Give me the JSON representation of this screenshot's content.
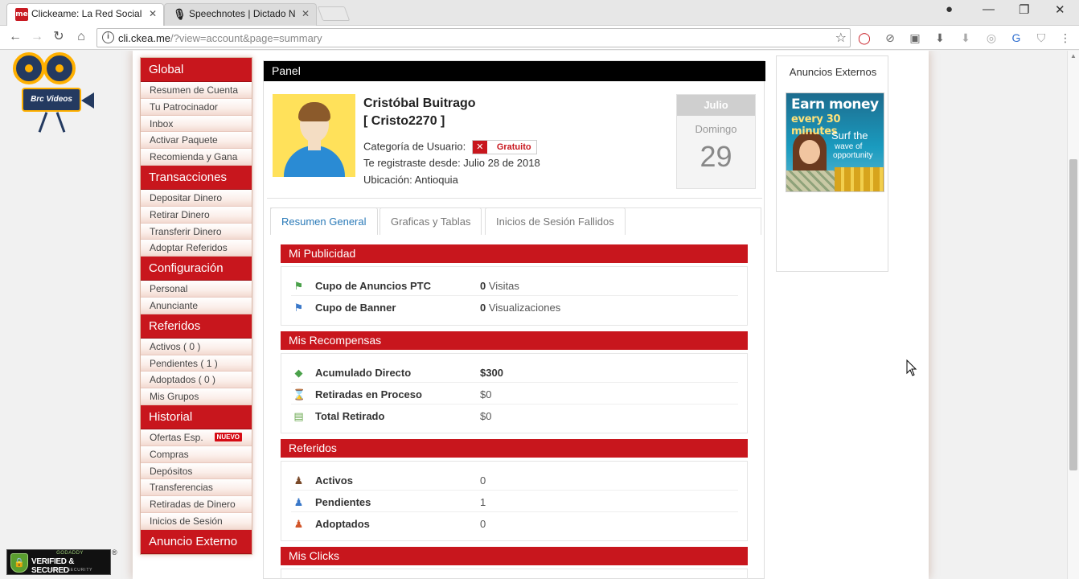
{
  "browser": {
    "tabs": [
      {
        "title": "Clickeame: La Red Social",
        "favicon": "me"
      },
      {
        "title": "Speechnotes | Dictado N",
        "favicon": "🎙"
      }
    ],
    "url_host": "cli.ckea.me",
    "url_path": "/?view=account&page=summary"
  },
  "logo": {
    "text": "Brc Videos"
  },
  "sidebar": {
    "sections": [
      {
        "title": "Global",
        "items": [
          "Resumen de Cuenta",
          "Tu Patrocinador",
          "Inbox",
          "Activar Paquete",
          "Recomienda y Gana"
        ]
      },
      {
        "title": "Transacciones",
        "items": [
          "Depositar Dinero",
          "Retirar Dinero",
          "Transferir Dinero",
          "Adoptar Referidos"
        ]
      },
      {
        "title": "Configuración",
        "items": [
          "Personal",
          "Anunciante"
        ]
      },
      {
        "title": "Referidos",
        "items": [
          "Activos ( 0 )",
          "Pendientes ( 1 )",
          "Adoptados ( 0 )",
          "Mis Grupos"
        ]
      },
      {
        "title": "Historial",
        "items": [
          "Ofertas Esp.",
          "Compras",
          "Depósitos",
          "Transferencias",
          "Retiradas de Dinero",
          "Inicios de Sesión"
        ]
      },
      {
        "title": "Anuncio Externo",
        "items": []
      }
    ],
    "new_badge": "NUEVO"
  },
  "panel": {
    "title": "Panel",
    "user": {
      "name": "Cristóbal Buitrago",
      "username": "[ Cristo2270 ]",
      "category_label": "Categoría de Usuario:",
      "category": "Gratuito",
      "registered": "Te registraste desde: Julio 28 de 2018",
      "location": "Ubicación: Antioquia"
    },
    "date": {
      "month": "Julio",
      "weekday": "Domingo",
      "day": "29"
    },
    "tabs": [
      "Resumen General",
      "Graficas y Tablas",
      "Inicios de Sesión Fallidos"
    ],
    "sections": {
      "publicidad": {
        "title": "Mi Publicidad",
        "rows": [
          {
            "label": "Cupo de Anuncios PTC",
            "num": "0",
            "unit": "Visitas"
          },
          {
            "label": "Cupo de Banner",
            "num": "0",
            "unit": "Visualizaciones"
          }
        ]
      },
      "recompensas": {
        "title": "Mis Recompensas",
        "rows": [
          {
            "label": "Acumulado Directo",
            "value": "$300"
          },
          {
            "label": "Retiradas en Proceso",
            "value": "$0"
          },
          {
            "label": "Total Retirado",
            "value": "$0"
          }
        ]
      },
      "referidos": {
        "title": "Referidos",
        "rows": [
          {
            "label": "Activos",
            "value": "0"
          },
          {
            "label": "Pendientes",
            "value": "1"
          },
          {
            "label": "Adoptados",
            "value": "0"
          }
        ]
      },
      "clicks": {
        "title": "Mis Clicks"
      }
    }
  },
  "ads": {
    "title": "Anuncios Externos",
    "banner": {
      "line1": "Earn money",
      "line2": "every 30 minutes",
      "line3": "Surf the",
      "line4": "wave of",
      "line5": "opportunity"
    }
  },
  "seal": {
    "top": "GODADDY",
    "main": "VERIFIED & SECURED",
    "bottom": "VERIFY SECURITY",
    "reg": "®"
  }
}
